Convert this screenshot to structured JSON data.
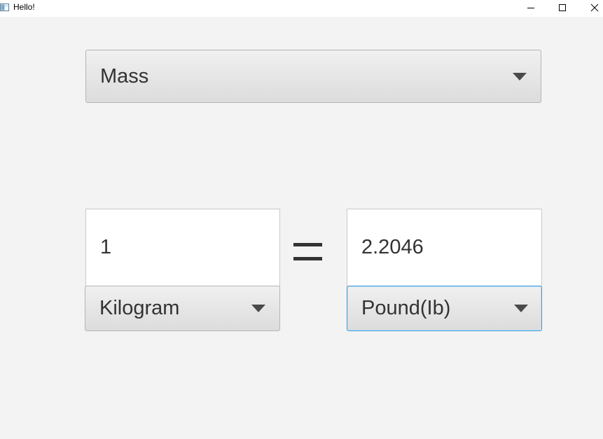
{
  "window": {
    "title": "Hello!",
    "icon": "java-app-icon",
    "controls": [
      "minimize-icon",
      "maximize-icon",
      "close-icon"
    ]
  },
  "converter": {
    "category": {
      "selected": "Mass"
    },
    "from": {
      "value": "1",
      "unit": "Kilogram"
    },
    "to": {
      "value": "2.2046",
      "unit": "Pound(Ib)"
    },
    "operator": "="
  },
  "colors": {
    "background": "#f3f3f3",
    "text": "#333333",
    "focus_border": "#3a9ddb"
  }
}
